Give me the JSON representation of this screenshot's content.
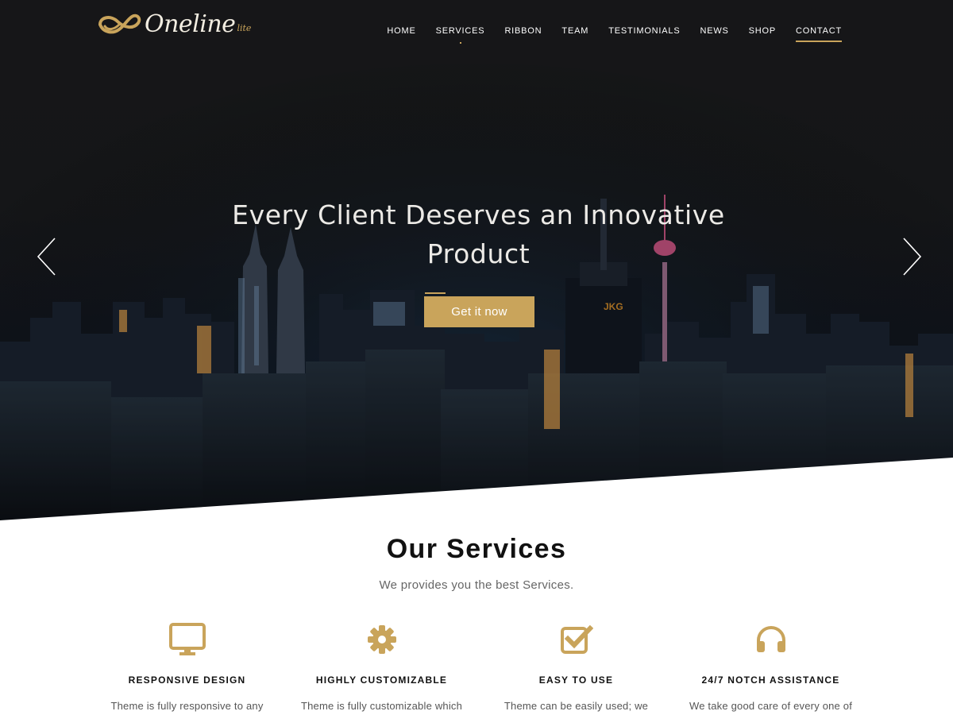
{
  "brand": {
    "name": "Oneline",
    "suffix": "lite",
    "accent": "#c9a45b"
  },
  "nav": {
    "items": [
      {
        "label": "HOME",
        "active": false
      },
      {
        "label": "SERVICES",
        "active": false
      },
      {
        "label": "RIBBON",
        "active": false
      },
      {
        "label": "TEAM",
        "active": false
      },
      {
        "label": "TESTIMONIALS",
        "active": false
      },
      {
        "label": "NEWS",
        "active": false
      },
      {
        "label": "SHOP",
        "active": false
      },
      {
        "label": "CONTACT",
        "active": true
      }
    ]
  },
  "hero": {
    "title": "Every Client Deserves an Innovative Product",
    "button": "Get it now",
    "prev_icon": "chevron-left-icon",
    "next_icon": "chevron-right-icon"
  },
  "services": {
    "title": "Our Services",
    "subtitle": "We provides you the best Services.",
    "items": [
      {
        "icon": "monitor-icon",
        "name": "RESPONSIVE DESIGN",
        "desc": "Theme is fully responsive to any"
      },
      {
        "icon": "gear-icon",
        "name": "HIGHLY CUSTOMIZABLE",
        "desc": "Theme is fully customizable which"
      },
      {
        "icon": "checkbox-icon",
        "name": "EASY TO USE",
        "desc": "Theme can be easily used; we"
      },
      {
        "icon": "headphones-icon",
        "name": "24/7 NOTCH ASSISTANCE",
        "desc": "We take good care of every one of"
      }
    ]
  }
}
